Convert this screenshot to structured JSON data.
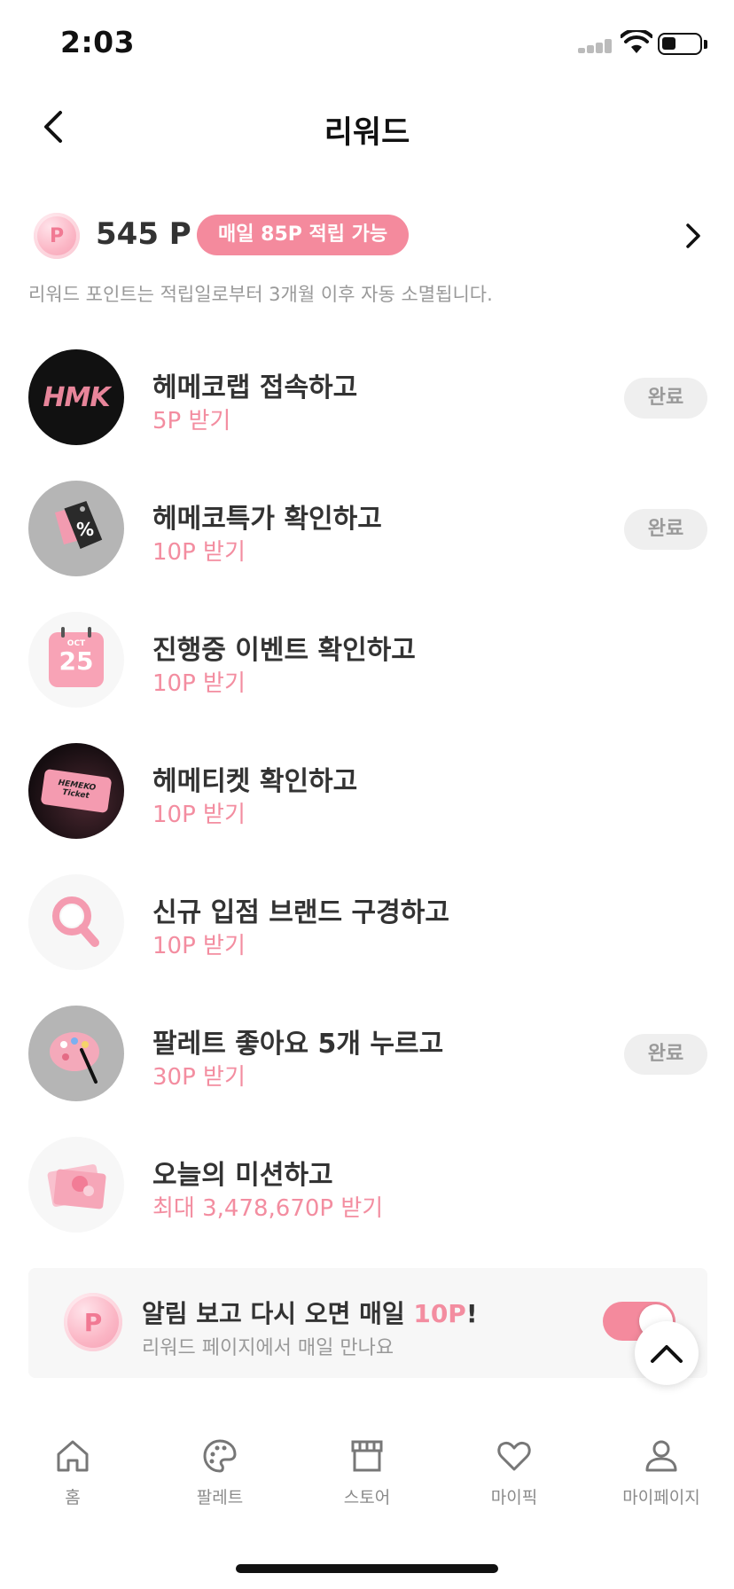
{
  "status_bar": {
    "time": "2:03"
  },
  "header": {
    "title": "리워드",
    "back_icon": "chevron-left-icon"
  },
  "points": {
    "value": "545 P",
    "coin_letter": "P",
    "daily_badge": "매일 85P 적립 가능",
    "notice": "리워드 포인트는 적립일로부터 3개월 이후 자동 소멸됩니다."
  },
  "missions": [
    {
      "title": "헤메코랩 접속하고",
      "reward": "5P 받기",
      "done_label": "완료",
      "icon": "hmk-logo-icon",
      "icon_text": "HMK"
    },
    {
      "title": "헤메코특가 확인하고",
      "reward": "10P 받기",
      "done_label": "완료",
      "icon": "discount-tag-icon"
    },
    {
      "title": "진행중 이벤트 확인하고",
      "reward": "10P 받기",
      "icon": "calendar-icon",
      "icon_month": "OCT",
      "icon_day": "25"
    },
    {
      "title": "헤메티켓 확인하고",
      "reward": "10P 받기",
      "icon": "ticket-icon",
      "icon_line1": "HEMEKO",
      "icon_line2": "Ticket"
    },
    {
      "title": "신규 입점 브랜드 구경하고",
      "reward": "10P 받기",
      "icon": "magnifier-icon"
    },
    {
      "title": "팔레트 좋아요 5개 누르고",
      "reward": "30P 받기",
      "done_label": "완료",
      "icon": "palette-icon"
    },
    {
      "title": "오늘의 미션하고",
      "reward": "최대 3,478,670P 받기",
      "icon": "mission-card-icon"
    }
  ],
  "notification": {
    "title_prefix": "알림 보고 다시 오면 매일 ",
    "title_accent": "10P",
    "title_suffix": "!",
    "subtitle": "리워드 페이지에서 매일 만나요",
    "toggle_on": true
  },
  "nav": [
    {
      "label": "홈",
      "icon": "home-icon"
    },
    {
      "label": "팔레트",
      "icon": "palette-icon"
    },
    {
      "label": "스토어",
      "icon": "store-icon"
    },
    {
      "label": "마이픽",
      "icon": "heart-icon"
    },
    {
      "label": "마이페이지",
      "icon": "person-icon"
    }
  ],
  "colors": {
    "accent": "#f48a9d",
    "accent_text": "#f38da0",
    "done_bg": "#efefef"
  }
}
